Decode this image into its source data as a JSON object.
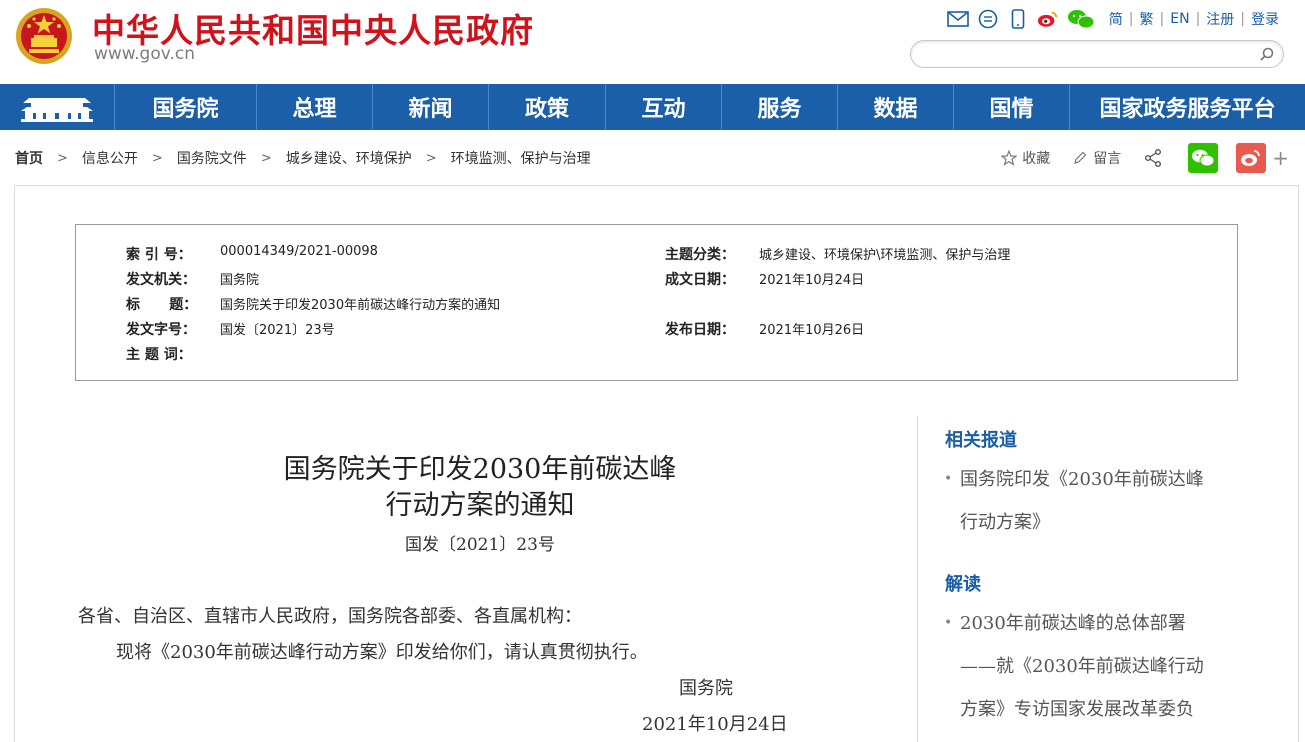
{
  "header": {
    "site_name": "中华人民共和国中央人民政府",
    "site_domain": "www.gov.cn",
    "top_links": [
      "简",
      "繁",
      "EN",
      "注册",
      "登录"
    ],
    "top_icons": [
      "mail-icon",
      "chat-bubble-icon",
      "mobile-icon",
      "weibo-icon",
      "wechat-icon"
    ],
    "search_placeholder": ""
  },
  "nav": {
    "items": [
      "国务院",
      "总理",
      "新闻",
      "政策",
      "互动",
      "服务",
      "数据",
      "国情",
      "国家政务服务平台"
    ]
  },
  "breadcrumb": {
    "items": [
      "首页",
      "信息公开",
      "国务院文件",
      "城乡建设、环境保护",
      "环境监测、保护与治理"
    ]
  },
  "tools": {
    "favorite": "收藏",
    "comment": "留言"
  },
  "meta": {
    "index_no_label": "索 引 号：",
    "index_no": "000014349/2021-00098",
    "topic_label": "主题分类：",
    "topic": "城乡建设、环境保护\\环境监测、保护与治理",
    "issuer_label": "发文机关：",
    "issuer": "国务院",
    "date_written_label": "成文日期：",
    "date_written": "2021年10月24日",
    "title_label": "标      题：",
    "title": "国务院关于印发2030年前碳达峰行动方案的通知",
    "doc_no_label": "发文字号：",
    "doc_no": "国发〔2021〕23号",
    "publish_date_label": "发布日期：",
    "publish_date": "2021年10月26日",
    "keywords_label": "主 题 词："
  },
  "article": {
    "title_line1": "国务院关于印发2030年前碳达峰",
    "title_line2": "行动方案的通知",
    "doc_no": "国发〔2021〕23号",
    "salutation": "各省、自治区、直辖市人民政府，国务院各部委、各直属机构：",
    "paragraph1": "现将《2030年前碳达峰行动方案》印发给你们，请认真贯彻执行。",
    "signature": "国务院",
    "date": "2021年10月24日"
  },
  "sidebar": {
    "related_heading": "相关报道",
    "related_items": [
      {
        "line1": "国务院印发《2030年前碳达峰",
        "line2": "行动方案》"
      }
    ],
    "interpret_heading": "解读",
    "interpret_items": [
      {
        "line1": "2030年前碳达峰的总体部署",
        "line2": "——就《2030年前碳达峰行动",
        "line3": "方案》专访国家发展改革委负"
      }
    ]
  },
  "colors": {
    "brand_red": "#d0121b",
    "nav_blue": "#1a5fa8",
    "link_blue": "#1a5ea6",
    "wechat_green": "#2dc100",
    "weibo_red": "#e8594f"
  }
}
